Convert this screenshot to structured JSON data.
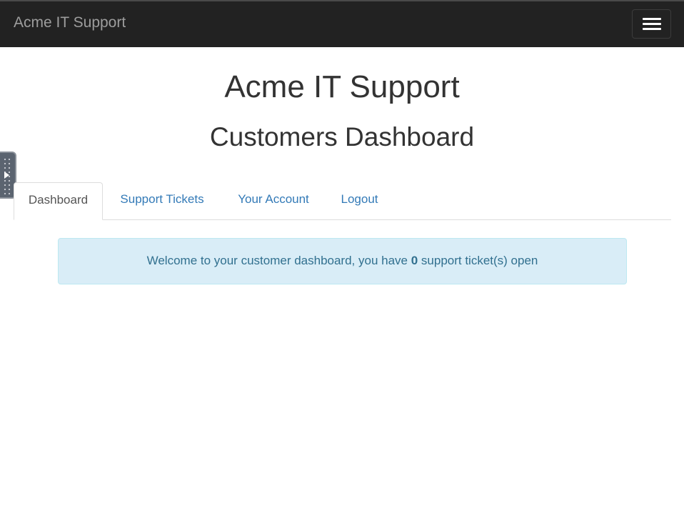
{
  "navbar": {
    "brand": "Acme IT Support",
    "menu_toggle_icon": "hamburger-menu-icon"
  },
  "side_handle": {
    "icon": "play-icon"
  },
  "header": {
    "title": "Acme IT Support",
    "subtitle": "Customers Dashboard"
  },
  "tabs": [
    {
      "label": "Dashboard",
      "active": true
    },
    {
      "label": "Support Tickets",
      "active": false
    },
    {
      "label": "Your Account",
      "active": false
    },
    {
      "label": "Logout",
      "active": false
    }
  ],
  "alert": {
    "prefix": "Welcome to your customer dashboard, you have ",
    "count": "0",
    "suffix": " support ticket(s) open"
  },
  "colors": {
    "navbar_bg": "#222222",
    "brand_text": "#9d9d9d",
    "link": "#337ab7",
    "alert_bg": "#d9edf7",
    "alert_text": "#31708f"
  }
}
